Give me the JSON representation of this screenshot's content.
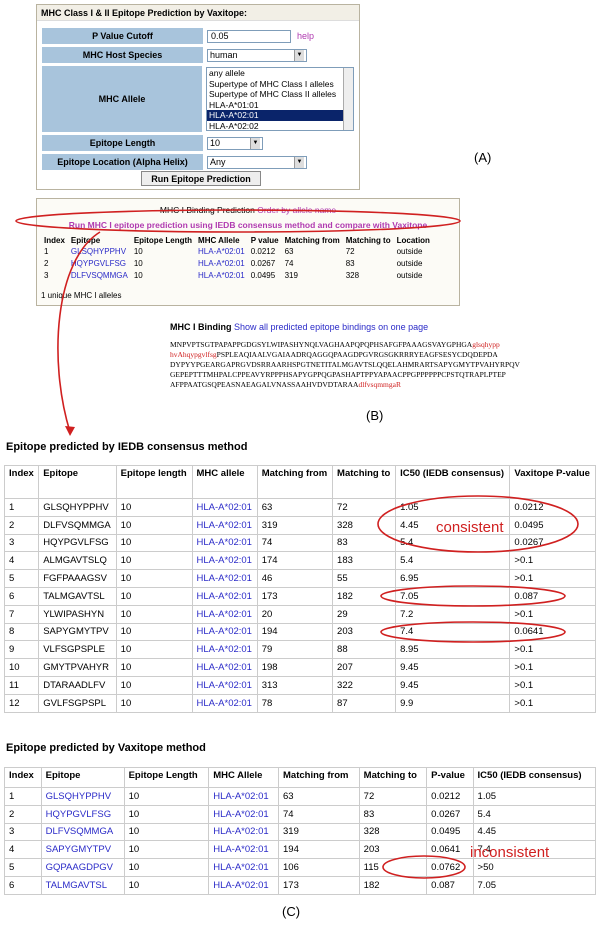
{
  "panelA": {
    "title": "MHC Class I & II Epitope Prediction by Vaxitope:",
    "p_value_label": "P Value Cutoff",
    "p_value": "0.05",
    "help": "help",
    "species_label": "MHC Host Species",
    "species_value": "human",
    "allele_label": "MHC Allele",
    "allele_options": [
      "any allele",
      "Supertype of MHC Class I alleles",
      "Supertype of MHC Class II alleles",
      "HLA-A*01:01",
      "HLA-A*02:01",
      "HLA-A*02:02"
    ],
    "allele_selected_index": 4,
    "length_label": "Epitope Length",
    "length_value": "10",
    "location_label": "Epitope Location (Alpha Helix)",
    "location_value": "Any",
    "run_button": "Run Epitope Prediction"
  },
  "labels": {
    "a": "(A)",
    "b": "(B)",
    "c": "(C)"
  },
  "panelB": {
    "title": "MHC I Binding Prediction",
    "order_link": "Order by allele name",
    "run_link": "Run MHC I epitope prediction using IEDB consensus method and compare with Vaxitope",
    "headers": [
      "Index",
      "Epitope",
      "Epitope Length",
      "MHC Allele",
      "P value",
      "Matching from",
      "Matching to",
      "Location"
    ],
    "rows": [
      [
        "1",
        "GLSQHYPPHV",
        "10",
        "HLA-A*02:01",
        "0.0212",
        "63",
        "72",
        "outside"
      ],
      [
        "2",
        "HQYPGVLFSG",
        "10",
        "HLA-A*02:01",
        "0.0267",
        "74",
        "83",
        "outside"
      ],
      [
        "3",
        "DLFVSQMMGA",
        "10",
        "HLA-A*02:01",
        "0.0495",
        "319",
        "328",
        "outside"
      ]
    ],
    "unique": "1 unique MHC I alleles"
  },
  "sequence": {
    "title": "MHC I Binding",
    "link": "Show all predicted epitope bindings on one page",
    "lines": [
      [
        {
          "t": "MNPVPTSGTPAPAPPGDGSYLWIPASHYNQLVAGHAAPQPQPHSAFGFPAAAGSVAYGPHGA",
          "r": false
        },
        {
          "t": "glsqhypp",
          "r": true
        }
      ],
      [
        {
          "t": "hvA",
          "r": true
        },
        {
          "t": "hqypgvlfsg",
          "r": true
        },
        {
          "t": "PSPLEAQIAALVGAIAADRQAGGQPAAGDPGVRGSGKRRRYEAGFSESYCDQDEPDA",
          "r": false
        }
      ],
      [
        {
          "t": "DYPYYPGEARGAPRGVDSRRAARHSPGTNETITALMGAVTSLQQELAHMRARTSAPYGMYTPVAHYRPQV",
          "r": false
        }
      ],
      [
        {
          "t": "GEPEPTTTMHPALCPPEAVYRPPPHSAPYGPPQGPASHAPTPPYAPAACPPGPPPPPPCPSTQTRAPLPTEP",
          "r": false
        }
      ],
      [
        {
          "t": "AFPPAATGSQPEASNAEAGALVNASSAAHVDVDTARAA",
          "r": false
        },
        {
          "t": "dlfvsqmmga",
          "r": true
        },
        {
          "t": "R",
          "r": true
        }
      ]
    ]
  },
  "iedb": {
    "title": "Epitope predicted by IEDB consensus method",
    "headers": [
      "Index",
      "Epitope",
      "Epitope length",
      "MHC allele",
      "Matching from",
      "Matching to",
      "IC50 (IEDB consensus)",
      "Vaxitope P-value"
    ],
    "rows": [
      [
        "1",
        "GLSQHYPPHV",
        "10",
        "HLA-A*02:01",
        "63",
        "72",
        "1.05",
        "0.0212"
      ],
      [
        "2",
        "DLFVSQMMGA",
        "10",
        "HLA-A*02:01",
        "319",
        "328",
        "4.45",
        "0.0495"
      ],
      [
        "3",
        "HQYPGVLFSG",
        "10",
        "HLA-A*02:01",
        "74",
        "83",
        "5.4",
        "0.0267"
      ],
      [
        "4",
        "ALMGAVTSLQ",
        "10",
        "HLA-A*02:01",
        "174",
        "183",
        "5.4",
        ">0.1"
      ],
      [
        "5",
        "FGFPAAAGSV",
        "10",
        "HLA-A*02:01",
        "46",
        "55",
        "6.95",
        ">0.1"
      ],
      [
        "6",
        "TALMGAVTSL",
        "10",
        "HLA-A*02:01",
        "173",
        "182",
        "7.05",
        "0.087"
      ],
      [
        "7",
        "YLWIPASHYN",
        "10",
        "HLA-A*02:01",
        "20",
        "29",
        "7.2",
        ">0.1"
      ],
      [
        "8",
        "SAPYGMYTPV",
        "10",
        "HLA-A*02:01",
        "194",
        "203",
        "7.4",
        "0.0641"
      ],
      [
        "9",
        "VLFSGPSPLE",
        "10",
        "HLA-A*02:01",
        "79",
        "88",
        "8.95",
        ">0.1"
      ],
      [
        "10",
        "GMYTPVAHYR",
        "10",
        "HLA-A*02:01",
        "198",
        "207",
        "9.45",
        ">0.1"
      ],
      [
        "11",
        "DTARAADLFV",
        "10",
        "HLA-A*02:01",
        "313",
        "322",
        "9.45",
        ">0.1"
      ],
      [
        "12",
        "GVLFSGPSPL",
        "10",
        "HLA-A*02:01",
        "78",
        "87",
        "9.9",
        ">0.1"
      ]
    ],
    "annotation": "consistent"
  },
  "vaxitope": {
    "title": "Epitope predicted by Vaxitope method",
    "headers": [
      "Index",
      "Epitope",
      "Epitope Length",
      "MHC Allele",
      "Matching from",
      "Matching to",
      "P-value",
      "IC50 (IEDB consensus)"
    ],
    "rows": [
      [
        "1",
        "GLSQHYPPHV",
        "10",
        "HLA-A*02:01",
        "63",
        "72",
        "0.0212",
        "1.05"
      ],
      [
        "2",
        "HQYPGVLFSG",
        "10",
        "HLA-A*02:01",
        "74",
        "83",
        "0.0267",
        "5.4"
      ],
      [
        "3",
        "DLFVSQMMGA",
        "10",
        "HLA-A*02:01",
        "319",
        "328",
        "0.0495",
        "4.45"
      ],
      [
        "4",
        "SAPYGMYTPV",
        "10",
        "HLA-A*02:01",
        "194",
        "203",
        "0.0641",
        "7.4"
      ],
      [
        "5",
        "GQPAAGDPGV",
        "10",
        "HLA-A*02:01",
        "106",
        "115",
        "0.0762",
        ">50"
      ],
      [
        "6",
        "TALMGAVTSL",
        "10",
        "HLA-A*02:01",
        "173",
        "182",
        "0.087",
        "7.05"
      ]
    ],
    "annotation": "inconsistent"
  },
  "colors": {
    "annotation_red": "#d02020",
    "link_blue": "#2b2bc8",
    "label_blue": "#a8c4dc",
    "link_purple": "#b03ab0"
  }
}
